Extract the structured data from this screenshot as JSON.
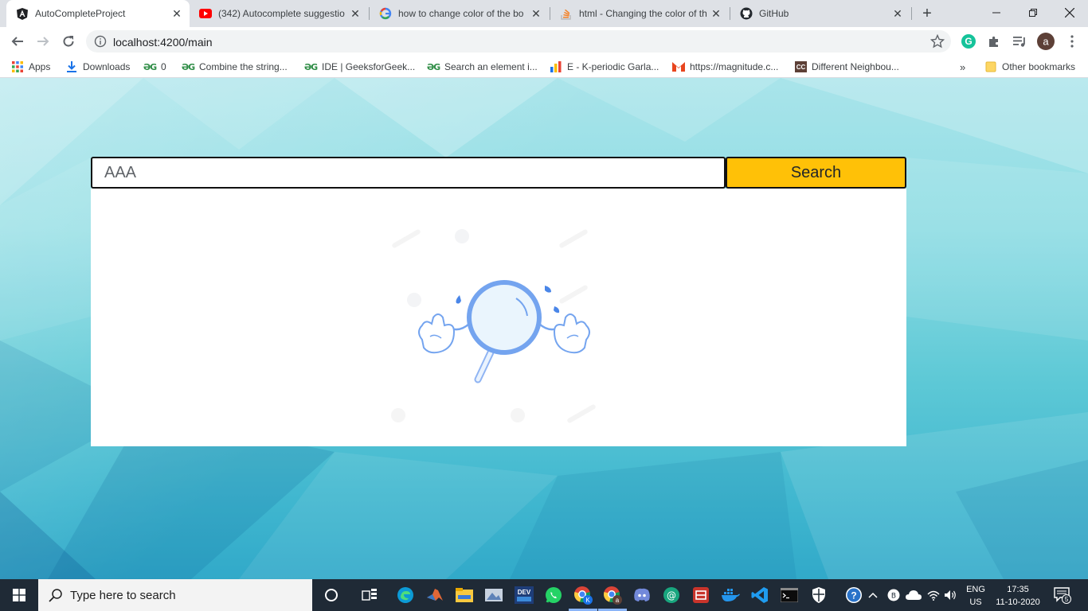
{
  "browser": {
    "tabs": [
      {
        "title": "AutoCompleteProject",
        "icon": "angular-icon",
        "active": true
      },
      {
        "title": "(342) Autocomplete suggestio",
        "icon": "youtube-icon",
        "active": false
      },
      {
        "title": "how to change color of the bo",
        "icon": "google-icon",
        "active": false
      },
      {
        "title": "html - Changing the color of th",
        "icon": "stackoverflow-icon",
        "active": false
      },
      {
        "title": "GitHub",
        "icon": "github-icon",
        "active": false
      }
    ],
    "new_tab_label": "+",
    "address": "localhost:4200/main",
    "profile_initial": "a",
    "grammarly_initial": "G"
  },
  "bookmarks": {
    "apps_label": "Apps",
    "items": [
      {
        "label": "Downloads",
        "icon": "download-icon"
      },
      {
        "label": "0",
        "icon": "gfg-icon"
      },
      {
        "label": "Combine the string...",
        "icon": "gfg-icon"
      },
      {
        "label": "IDE | GeeksforGeek...",
        "icon": "gfg-icon"
      },
      {
        "label": "Search an element i...",
        "icon": "gfg-icon"
      },
      {
        "label": "E - K-periodic Garla...",
        "icon": "bar-chart-icon"
      },
      {
        "label": "https://magnitude.c...",
        "icon": "mail-icon"
      },
      {
        "label": "Different Neighbou...",
        "icon": "cc-icon"
      }
    ],
    "overflow_label": "»",
    "other_label": "Other bookmarks",
    "cc_badge": "CC"
  },
  "page": {
    "search_value": "AAA",
    "search_button_label": "Search",
    "empty_illustration": "no-results-magnifier-illustration"
  },
  "taskbar": {
    "search_placeholder": "Type here to search",
    "language_line1": "ENG",
    "language_line2": "US",
    "time": "17:35",
    "date": "11-10-2020",
    "notification_count": "5",
    "dev_label": "DEV",
    "chrome_profile_k": "K",
    "chrome_profile_a": "a"
  },
  "colors": {
    "search_button": "#ffc107",
    "page_gradient_top": "#a9e4ea",
    "page_gradient_bottom": "#31a9c9",
    "taskbar": "#1f2a36"
  }
}
